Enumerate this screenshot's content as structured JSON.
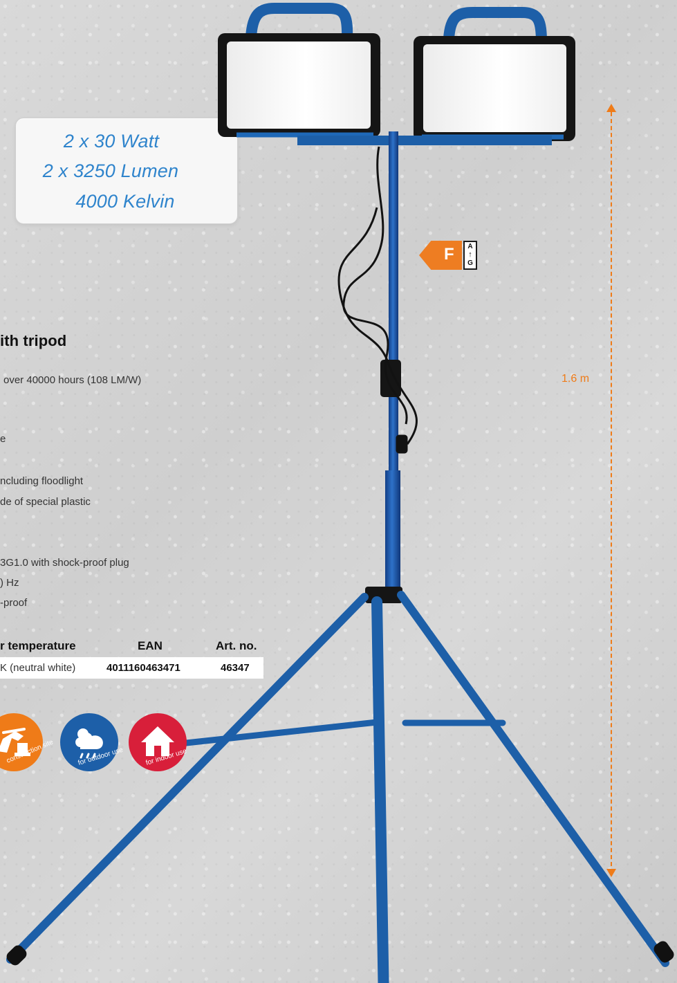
{
  "callout": {
    "line1": "2 x 30  Watt",
    "line2": "2 x 3250  Lumen",
    "line3": "4000  Kelvin"
  },
  "energy_label": {
    "grade": "F",
    "scale_top": "A",
    "scale_arrow": "↑",
    "scale_bottom": "G"
  },
  "dimension": {
    "height": "1.6 m"
  },
  "product": {
    "title": "ith tripod",
    "features": [
      "over 40000 hours (108 LM/W)",
      "e",
      "ncluding floodlight",
      "de of special plastic",
      "3G1.0 with shock-proof plug",
      ") Hz",
      "-proof"
    ]
  },
  "table": {
    "headers": [
      "r temperature",
      "EAN",
      "Art. no."
    ],
    "row": {
      "color_temperature": "K (neutral white)",
      "ean": "4011160463471",
      "art_no": "46347"
    }
  },
  "icons": {
    "construction": "construction site",
    "outdoor": "for outdoor use",
    "indoor": "for indoor use"
  },
  "colors": {
    "blue_text": "#2f84cc",
    "orange": "#ef7b18",
    "blue_icon": "#1d5fa8",
    "red_icon": "#d81f3a"
  }
}
